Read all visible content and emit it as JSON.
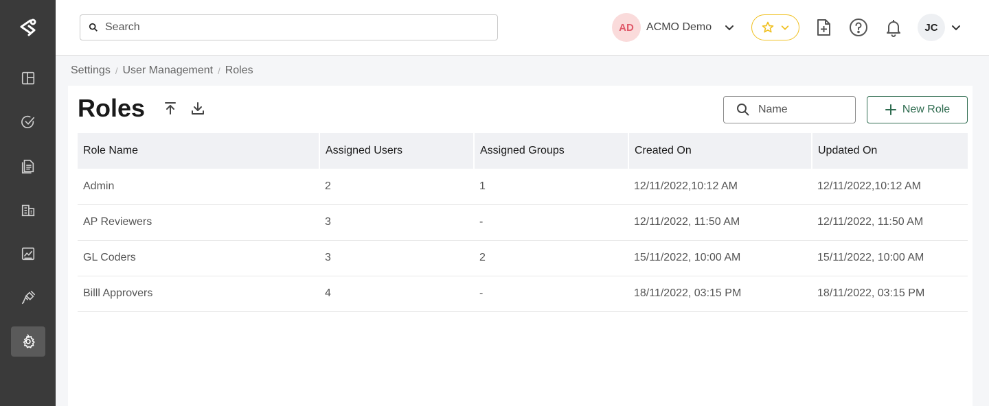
{
  "colors": {
    "sidebar": "#3a3a3a",
    "accent": "#2e6b4f",
    "favorite": "#f0c020",
    "org_avatar": "#e05a6a"
  },
  "sidebar": {
    "logo": "app-logo-icon",
    "items": [
      {
        "icon": "dashboard-icon"
      },
      {
        "icon": "tasks-check-icon"
      },
      {
        "icon": "documents-icon"
      },
      {
        "icon": "building-icon"
      },
      {
        "icon": "reports-chart-icon"
      },
      {
        "icon": "integrations-plug-icon"
      },
      {
        "icon": "settings-gear-icon",
        "active": true
      }
    ]
  },
  "header": {
    "search_placeholder": "Search",
    "org_initials": "AD",
    "org_name": "ACMO Demo",
    "user_initials": "JC"
  },
  "breadcrumb": [
    "Settings",
    "User Management",
    "Roles"
  ],
  "page": {
    "title": "Roles",
    "name_filter_placeholder": "Name",
    "new_role_label": "New Role"
  },
  "table": {
    "columns": [
      "Role Name",
      "Assigned Users",
      "Assigned Groups",
      "Created On",
      "Updated On"
    ],
    "rows": [
      [
        "Admin",
        "2",
        "1",
        "12/11/2022,10:12 AM",
        "12/11/2022,10:12 AM"
      ],
      [
        "AP Reviewers",
        "3",
        "-",
        "12/11/2022, 11:50 AM",
        "12/11/2022, 11:50 AM"
      ],
      [
        "GL Coders",
        "3",
        "2",
        "15/11/2022, 10:00 AM",
        "15/11/2022, 10:00 AM"
      ],
      [
        "Billl Approvers",
        "4",
        "-",
        "18/11/2022, 03:15 PM",
        "18/11/2022, 03:15 PM"
      ]
    ]
  }
}
